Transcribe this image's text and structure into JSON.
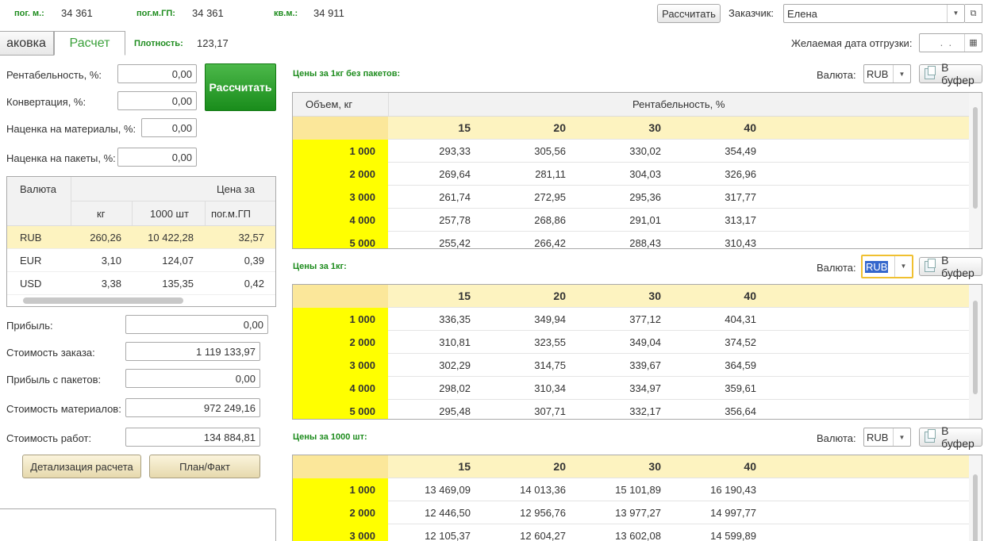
{
  "header": {
    "pog_m_label": "пог. м.:",
    "pog_m_value": "34 361",
    "pog_m_gp_label": "пог.м.ГП:",
    "pog_m_gp_value": "34 361",
    "kv_m_label": "кв.м.:",
    "kv_m_value": "34 911",
    "calc_button": "Рассчитать",
    "customer_label": "Заказчик:",
    "customer_value": "Елена",
    "ship_date_label": "Желаемая дата отгрузки:",
    "ship_date_value": " .  .",
    "density_label": "Плотность:",
    "density_value": "123,17"
  },
  "tabs": [
    {
      "label": "аковка"
    },
    {
      "label": "Расчет"
    }
  ],
  "params": {
    "profit_pct_label": "Рентабельность, %:",
    "profit_pct_value": "0,00",
    "conversion_label": "Конвертация, %:",
    "conversion_value": "0,00",
    "markup_mat_label": "Наценка на материалы, %:",
    "markup_mat_value": "0,00",
    "markup_pack_label": "Наценка на пакеты, %:",
    "markup_pack_value": "0,00",
    "calc_big_button": "Рассчитать"
  },
  "currency_table": {
    "col_currency": "Валюта",
    "col_price_for": "Цена за",
    "sub_kg": "кг",
    "sub_1000": "1000 шт",
    "sub_pogm": "пог.м.ГП",
    "rows": [
      {
        "cur": "RUB",
        "kg": "260,26",
        "k1000": "10 422,28",
        "pogm": "32,57"
      },
      {
        "cur": "EUR",
        "kg": "3,10",
        "k1000": "124,07",
        "pogm": "0,39"
      },
      {
        "cur": "USD",
        "kg": "3,38",
        "k1000": "135,35",
        "pogm": "0,42"
      }
    ]
  },
  "summary": {
    "profit_label": "Прибыль:",
    "profit_value": "0,00",
    "order_cost_label": "Стоимость заказа:",
    "order_cost_value": "1 119 133,97",
    "pack_profit_label": "Прибыль с пакетов:",
    "pack_profit_value": "0,00",
    "mat_cost_label": "Стоимость материалов:",
    "mat_cost_value": "972 249,16",
    "work_cost_label": "Стоимость работ:",
    "work_cost_value": "134 884,81",
    "detail_button": "Детализация расчета",
    "plan_fact_button": "План/Факт"
  },
  "section1": {
    "title": "Цены за 1кг без пакетов:",
    "currency_label": "Валюта:",
    "currency_value": "RUB",
    "buffer_button": "В буфер",
    "col_volume": "Объем, кг",
    "col_profit": "Рентабельность, %",
    "headers": [
      "15",
      "20",
      "30",
      "40"
    ],
    "rows": [
      {
        "vol": "1 000",
        "vals": [
          "293,33",
          "305,56",
          "330,02",
          "354,49"
        ]
      },
      {
        "vol": "2 000",
        "vals": [
          "269,64",
          "281,11",
          "304,03",
          "326,96"
        ]
      },
      {
        "vol": "3 000",
        "vals": [
          "261,74",
          "272,95",
          "295,36",
          "317,77"
        ]
      },
      {
        "vol": "4 000",
        "vals": [
          "257,78",
          "268,86",
          "291,01",
          "313,17"
        ]
      },
      {
        "vol": "5 000",
        "vals": [
          "255,42",
          "266,42",
          "288,43",
          "310,43"
        ]
      }
    ]
  },
  "section2": {
    "title": "Цены за 1кг:",
    "currency_label": "Валюта:",
    "currency_value": "RUB",
    "buffer_button": "В буфер",
    "headers": [
      "15",
      "20",
      "30",
      "40"
    ],
    "rows": [
      {
        "vol": "1 000",
        "vals": [
          "336,35",
          "349,94",
          "377,12",
          "404,31"
        ]
      },
      {
        "vol": "2 000",
        "vals": [
          "310,81",
          "323,55",
          "349,04",
          "374,52"
        ]
      },
      {
        "vol": "3 000",
        "vals": [
          "302,29",
          "314,75",
          "339,67",
          "364,59"
        ]
      },
      {
        "vol": "4 000",
        "vals": [
          "298,02",
          "310,34",
          "334,97",
          "359,61"
        ]
      },
      {
        "vol": "5 000",
        "vals": [
          "295,48",
          "307,71",
          "332,17",
          "356,64"
        ]
      }
    ]
  },
  "section3": {
    "title": "Цены за 1000 шт:",
    "currency_label": "Валюта:",
    "currency_value": "RUB",
    "buffer_button": "В буфер",
    "headers": [
      "15",
      "20",
      "30",
      "40"
    ],
    "rows": [
      {
        "vol": "1 000",
        "vals": [
          "13 469,09",
          "14 013,36",
          "15 101,89",
          "16 190,43"
        ]
      },
      {
        "vol": "2 000",
        "vals": [
          "12 446,50",
          "12 956,76",
          "13 977,27",
          "14 997,77"
        ]
      },
      {
        "vol": "3 000",
        "vals": [
          "12 105,37",
          "12 604,27",
          "13 602,08",
          "14 599,89"
        ]
      }
    ]
  },
  "colors": {
    "green": "#1e8c1e",
    "yellow": "#ffff00",
    "header_yellow": "#fdf3c0",
    "selected_row": "#fdf3c0"
  }
}
